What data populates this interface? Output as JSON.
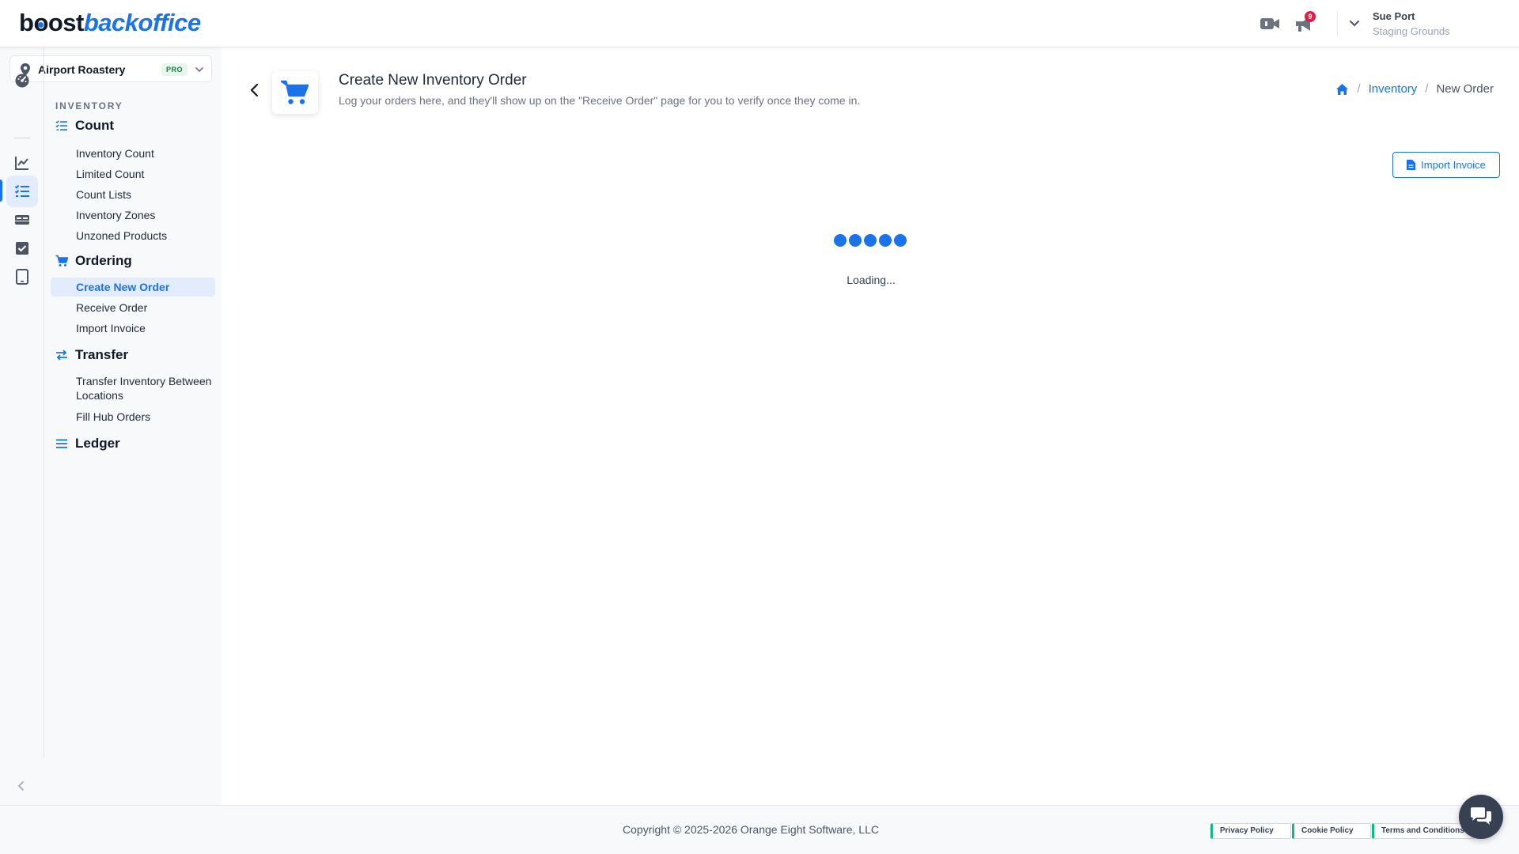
{
  "brand": {
    "logo_part1": "boost",
    "logo_part2": "backoffice",
    "accent_color": "#1a73e8"
  },
  "header": {
    "notification_count": "9",
    "user_name": "Sue Port",
    "user_org": "Staging Grounds",
    "icons": [
      "video-camera-icon",
      "megaphone-icon",
      "chevron-down-icon"
    ]
  },
  "location": {
    "name": "Airport Roastery",
    "badge": "PRO"
  },
  "rail": {
    "items": [
      "dashboard-icon",
      "analytics-icon",
      "inventory-checklist-icon",
      "cards-icon",
      "checkbox-icon",
      "tablet-icon"
    ],
    "active": "inventory-checklist-icon"
  },
  "sidebar": {
    "section_label": "INVENTORY",
    "groups": [
      {
        "title": "Count",
        "icon": "checklist-icon",
        "items": [
          "Inventory Count",
          "Limited Count",
          "Count Lists",
          "Inventory Zones",
          "Unzoned Products"
        ]
      },
      {
        "title": "Ordering",
        "icon": "cart-icon",
        "items": [
          "Create New Order",
          "Receive Order",
          "Import Invoice"
        ]
      },
      {
        "title": "Transfer",
        "icon": "transfer-arrows-icon",
        "items": [
          "Transfer Inventory Between Locations",
          "Fill Hub Orders"
        ]
      },
      {
        "title": "Ledger",
        "icon": "list-icon",
        "items": []
      }
    ],
    "active_item": "Create New Order"
  },
  "page": {
    "title": "Create New Inventory Order",
    "subtitle": "Log your orders here, and they'll show up on the \"Receive Order\" page for you to verify once they come in.",
    "import_button": "Import Invoice",
    "loading_text": "Loading..."
  },
  "breadcrumb": {
    "link": "Inventory",
    "current": "New Order",
    "separator": "/"
  },
  "footer": {
    "copyright": "Copyright © 2025-2026 Orange Eight Software, LLC",
    "links": [
      "Privacy Policy",
      "Cookie Policy",
      "Terms and Conditions"
    ]
  }
}
